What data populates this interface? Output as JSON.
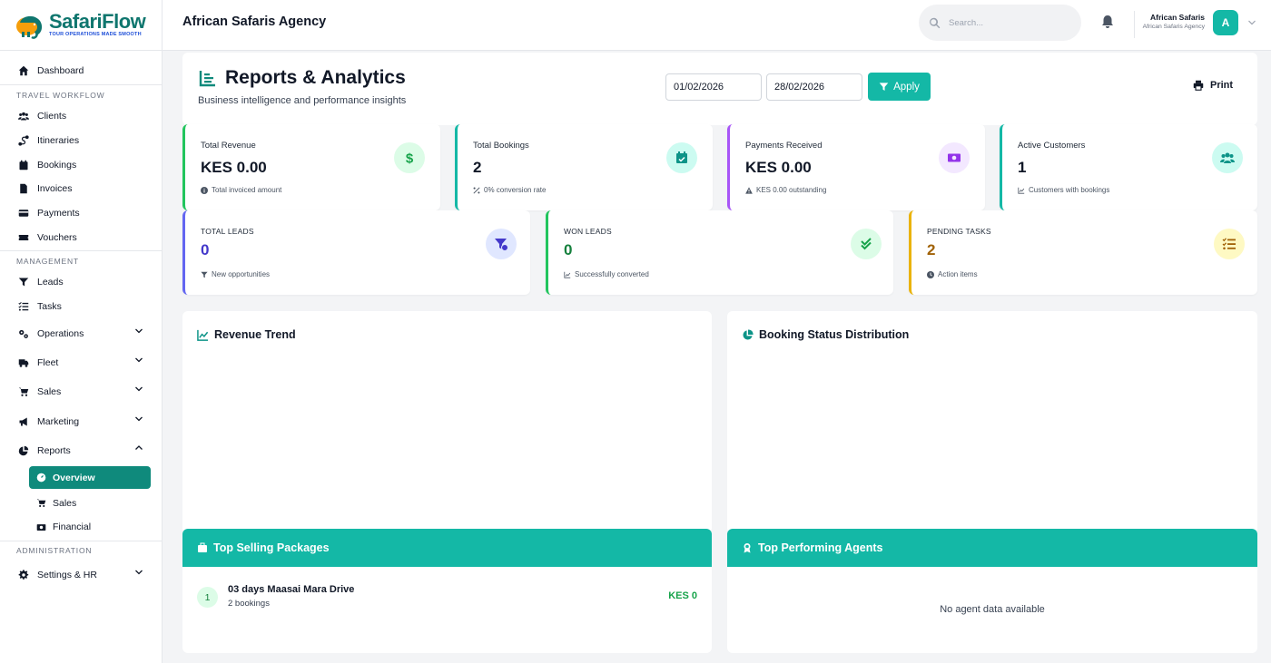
{
  "brand": {
    "name_part1": "Safari",
    "name_part2": "Flow",
    "tagline": "TOUR OPERATIONS MADE SMOOTH"
  },
  "topbar": {
    "agency": "African Safaris Agency",
    "search_placeholder": "Search...",
    "user_name": "African Safaris",
    "user_org": "African Safaris Agency",
    "avatar_letter": "A"
  },
  "sidebar": {
    "dashboard": "Dashboard",
    "sections": {
      "travel": "TRAVEL WORKFLOW",
      "management": "MANAGEMENT",
      "administration": "ADMINISTRATION"
    },
    "travel_items": [
      "Clients",
      "Itineraries",
      "Bookings",
      "Invoices",
      "Payments",
      "Vouchers"
    ],
    "management_items": [
      "Leads",
      "Tasks",
      "Operations",
      "Fleet",
      "Sales",
      "Marketing",
      "Reports"
    ],
    "reports_sub": [
      "Overview",
      "Sales",
      "Financial"
    ],
    "admin_items": [
      "Settings & HR"
    ]
  },
  "header": {
    "title": "Reports & Analytics",
    "subtitle": "Business intelligence and performance insights",
    "date_from": "01/02/2026",
    "date_to": "28/02/2026",
    "apply_label": "Apply",
    "print_label": "Print"
  },
  "stats_row1": [
    {
      "label": "Total Revenue",
      "value": "KES 0.00",
      "note": "Total invoiced amount",
      "color": "#22c55e"
    },
    {
      "label": "Total Bookings",
      "value": "2",
      "note": "0% conversion rate",
      "color": "#14b8a6"
    },
    {
      "label": "Payments Received",
      "value": "KES 0.00",
      "note": "KES 0.00 outstanding",
      "color": "#a855f7"
    },
    {
      "label": "Active Customers",
      "value": "1",
      "note": "Customers with bookings",
      "color": "#14b8a6"
    }
  ],
  "stats_row2": [
    {
      "label": "TOTAL LEADS",
      "value": "0",
      "note": "New opportunities",
      "color": "#6366f1"
    },
    {
      "label": "WON LEADS",
      "value": "0",
      "note": "Successfully converted",
      "color": "#22c55e"
    },
    {
      "label": "PENDING TASKS",
      "value": "2",
      "note": "Action items",
      "color": "#eab308"
    }
  ],
  "panels": {
    "revenue_trend": "Revenue Trend",
    "booking_status": "Booking Status Distribution",
    "top_packages": "Top Selling Packages",
    "top_agents": "Top Performing Agents",
    "no_agents": "No agent data available"
  },
  "packages": [
    {
      "rank": "1",
      "name": "03 days Maasai Mara Drive",
      "bookings": "2 bookings",
      "amount": "KES 0"
    }
  ]
}
